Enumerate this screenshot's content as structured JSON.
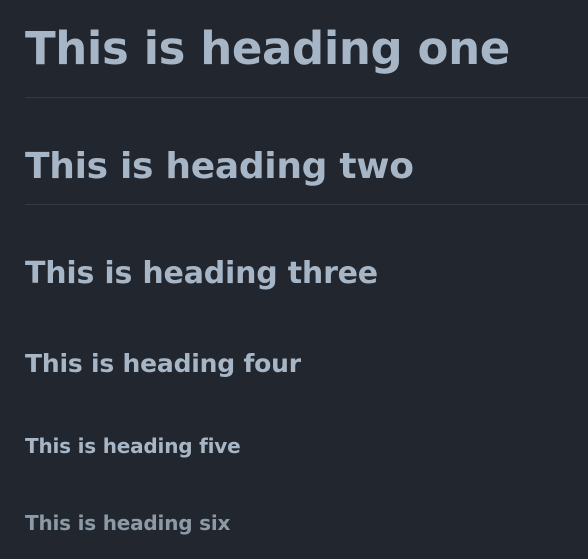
{
  "headings": {
    "h1": "This is heading one",
    "h2": "This is heading two",
    "h3": "This is heading three",
    "h4": "This is heading four",
    "h5": "This is heading five",
    "h6": "This is heading six"
  },
  "colors": {
    "background": "#22262e",
    "heading_text": "#a7b6c6",
    "heading_six_text": "#8c99a6",
    "divider": "#343a44"
  }
}
